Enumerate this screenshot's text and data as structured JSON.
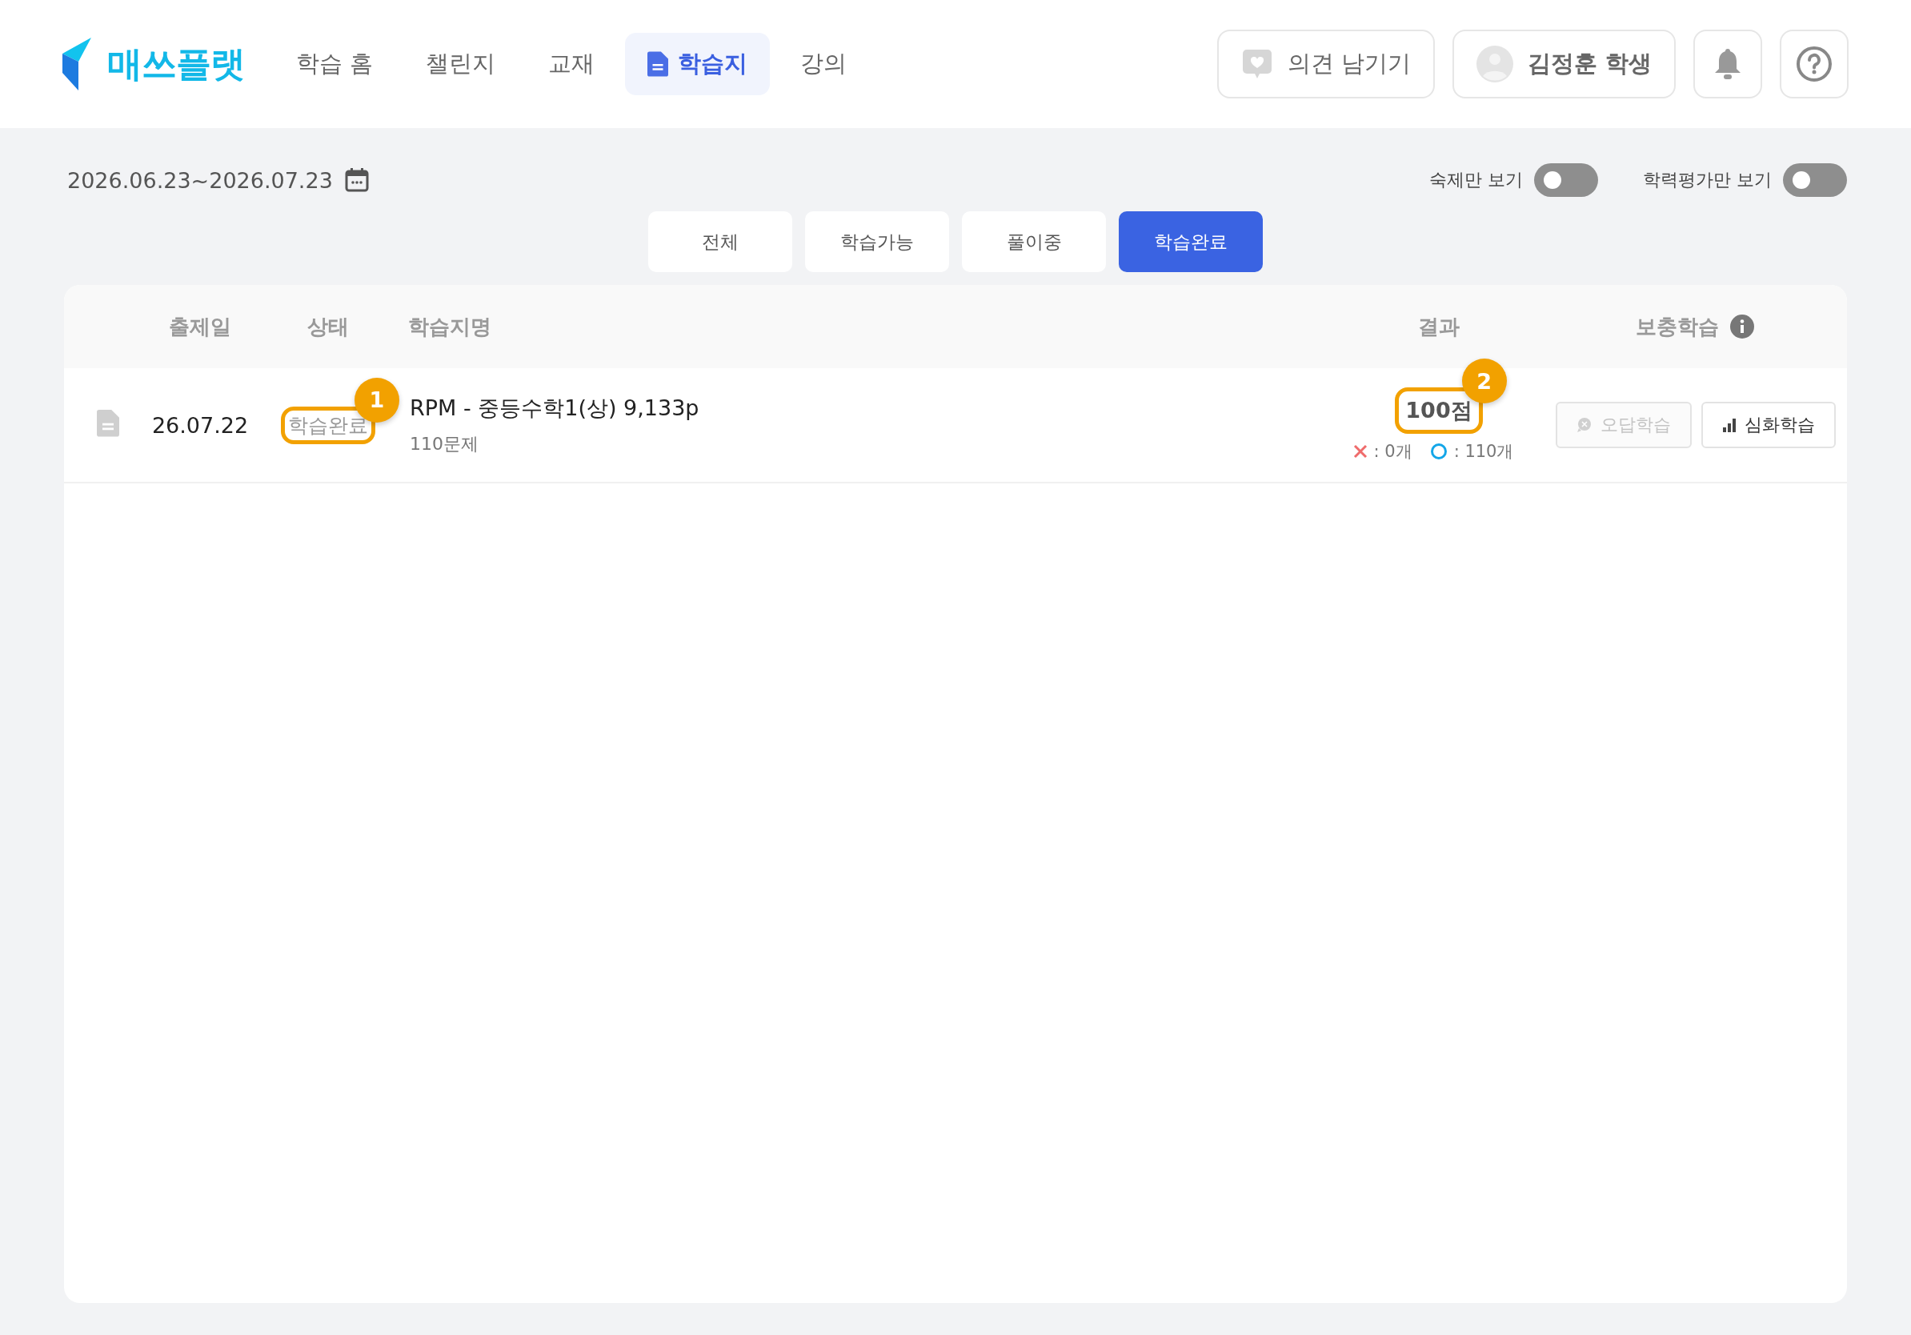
{
  "header": {
    "logo": "매쓰플랫",
    "nav": [
      {
        "label": "학습 홈",
        "selected": false
      },
      {
        "label": "챌린지",
        "selected": false
      },
      {
        "label": "교재",
        "selected": false
      },
      {
        "label": "학습지",
        "selected": true
      },
      {
        "label": "강의",
        "selected": false
      }
    ],
    "feedback": "의견 남기기",
    "user": "김정훈 학생"
  },
  "filters": {
    "date_range": "2026.06.23~2026.07.23",
    "toggles": [
      {
        "label": "숙제만 보기",
        "on": false
      },
      {
        "label": "학력평가만 보기",
        "on": false
      }
    ],
    "status_tabs": [
      {
        "label": "전체",
        "selected": false
      },
      {
        "label": "학습가능",
        "selected": false
      },
      {
        "label": "풀이중",
        "selected": false
      },
      {
        "label": "학습완료",
        "selected": true
      }
    ]
  },
  "table": {
    "columns": [
      "출제일",
      "상태",
      "학습지명",
      "결과",
      "보충학습"
    ],
    "rows": [
      {
        "date": "26.07.22",
        "status": "학습완료",
        "status_callout": "1",
        "title": "RPM - 중등수학1(상) 9,133p",
        "count": "110문제",
        "score": "100점",
        "score_callout": "2",
        "wrong": ": 0개",
        "correct": ": 110개",
        "actions": [
          {
            "label": "오답학습",
            "disabled": true
          },
          {
            "label": "심화학습",
            "disabled": false
          }
        ]
      }
    ]
  }
}
